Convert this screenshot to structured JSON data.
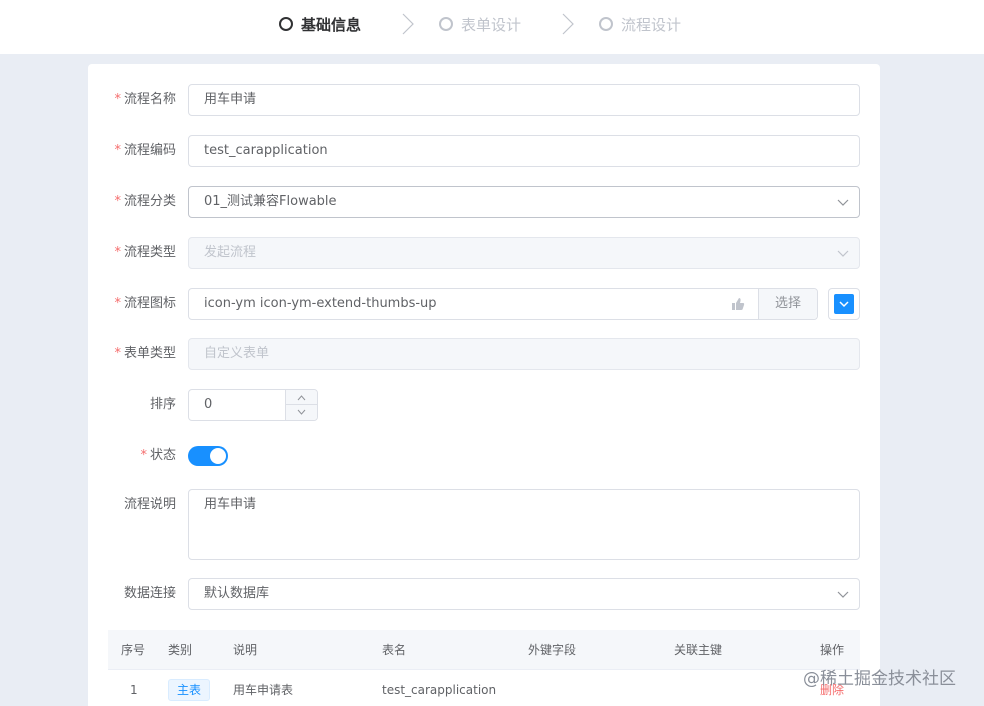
{
  "steps": [
    {
      "label": "基础信息",
      "active": true
    },
    {
      "label": "表单设计",
      "active": false
    },
    {
      "label": "流程设计",
      "active": false
    }
  ],
  "form": {
    "name": {
      "label": "流程名称",
      "value": "用车申请"
    },
    "code": {
      "label": "流程编码",
      "value": "test_carapplication"
    },
    "category": {
      "label": "流程分类",
      "value": "01_测试兼容Flowable"
    },
    "type": {
      "label": "流程类型",
      "placeholder": "发起流程"
    },
    "icon": {
      "label": "流程图标",
      "value": "icon-ym icon-ym-extend-thumbs-up",
      "select_label": "选择",
      "color": "#1890ff"
    },
    "form_type": {
      "label": "表单类型",
      "placeholder": "自定义表单"
    },
    "sort": {
      "label": "排序",
      "value": "0"
    },
    "status": {
      "label": "状态",
      "on": true
    },
    "description": {
      "label": "流程说明",
      "value": "用车申请"
    },
    "db_link": {
      "label": "数据连接",
      "value": "默认数据库"
    }
  },
  "table": {
    "headers": [
      "序号",
      "类别",
      "说明",
      "表名",
      "外键字段",
      "关联主键",
      "操作"
    ],
    "rows": [
      {
        "index": "1",
        "category": "主表",
        "description": "用车申请表",
        "table_name": "test_carapplication",
        "fk": "",
        "pk": "",
        "action": "删除"
      }
    ]
  },
  "watermark": "@稀土掘金技术社区",
  "colors": {
    "primary": "#1890ff",
    "danger": "#f56c6c"
  }
}
